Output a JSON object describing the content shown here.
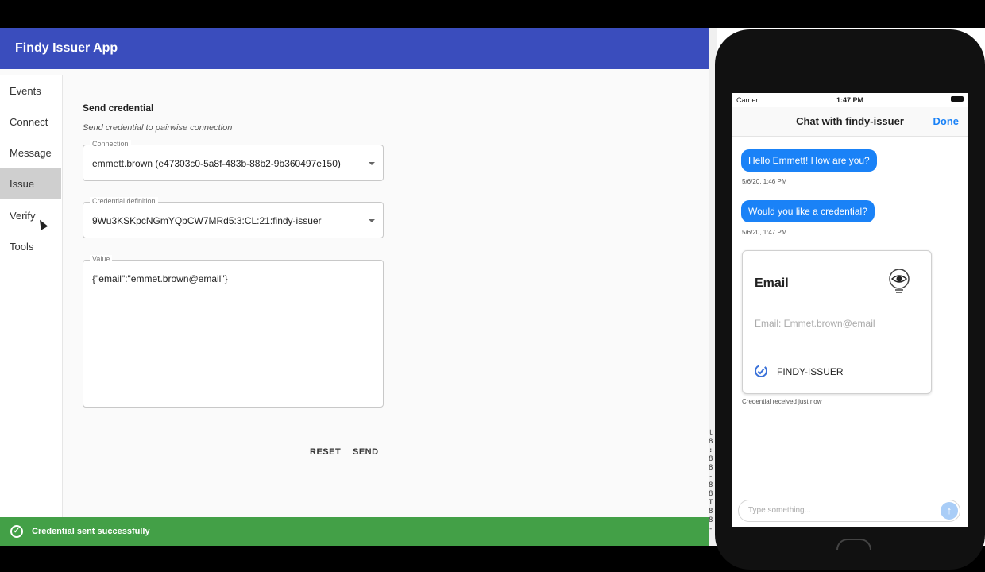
{
  "app": {
    "title": "Findy Issuer App"
  },
  "sidebar": {
    "items": [
      {
        "label": "Events",
        "active": false
      },
      {
        "label": "Connect",
        "active": false
      },
      {
        "label": "Message",
        "active": false
      },
      {
        "label": "Issue",
        "active": true
      },
      {
        "label": "Verify",
        "active": false
      },
      {
        "label": "Tools",
        "active": false
      }
    ]
  },
  "form": {
    "title": "Send credential",
    "subtitle": "Send credential to pairwise connection",
    "connection": {
      "label": "Connection",
      "value": "emmett.brown (e47303c0-5a8f-483b-88b2-9b360497e150)"
    },
    "credential_definition": {
      "label": "Credential definition",
      "value": "9Wu3KSKpcNGmYQbCW7MRd5:3:CL:21:findy-issuer"
    },
    "value": {
      "label": "Value",
      "text": "{\"email\":\"emmet.brown@email\"}"
    },
    "reset_label": "RESET",
    "send_label": "SEND"
  },
  "snackbar": {
    "text": "Credential sent successfully",
    "icon": "check-circle-icon",
    "color": "#43a047"
  },
  "phone": {
    "status": {
      "carrier": "Carrier",
      "time": "1:47 PM"
    },
    "chat": {
      "title": "Chat with findy-issuer",
      "done_label": "Done",
      "messages": [
        {
          "text": "Hello Emmett! How are you?",
          "time": "5/6/20, 1:46 PM"
        },
        {
          "text": "Would you like a credential?",
          "time": "5/6/20, 1:47 PM"
        }
      ],
      "credential": {
        "title": "Email",
        "attribute": "Email: Emmet.brown@email",
        "issuer": "FINDY-ISSUER",
        "status": "Credential received just now"
      },
      "composer_placeholder": "Type something..."
    }
  },
  "colors": {
    "app_bar": "#3a4dbd",
    "accent_blue": "#1a82f7"
  }
}
